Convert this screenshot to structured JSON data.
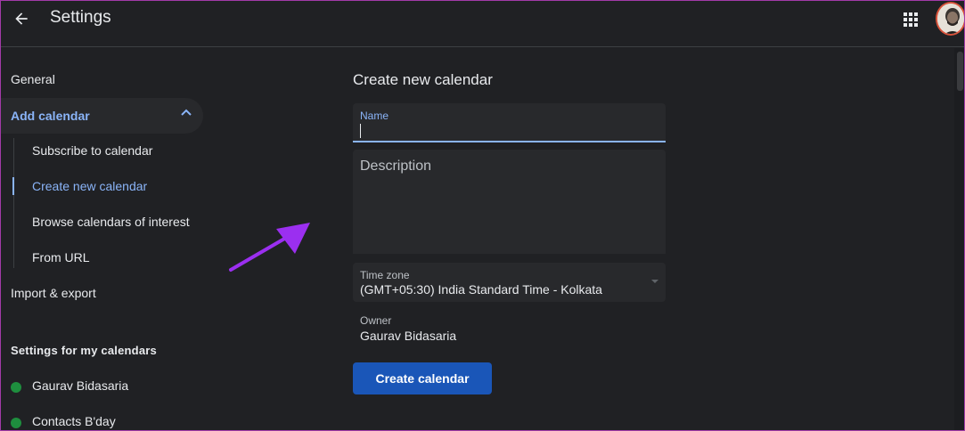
{
  "header": {
    "title": "Settings"
  },
  "sidebar": {
    "general": "General",
    "add_calendar": "Add calendar",
    "sub_items": [
      "Subscribe to calendar",
      "Create new calendar",
      "Browse calendars of interest",
      "From URL"
    ],
    "import_export": "Import & export",
    "section_title": "Settings for my calendars",
    "calendars": [
      {
        "name": "Gaurav Bidasaria",
        "color": "#1e8e3e"
      },
      {
        "name": "Contacts B'day",
        "color": "#1e8e3e"
      }
    ]
  },
  "main": {
    "title": "Create new calendar",
    "name_label": "Name",
    "name_value": "",
    "description_placeholder": "Description",
    "timezone_label": "Time zone",
    "timezone_value": "(GMT+05:30) India Standard Time - Kolkata",
    "owner_label": "Owner",
    "owner_value": "Gaurav Bidasaria",
    "create_button": "Create calendar"
  },
  "colors": {
    "accent": "#8ab4f8",
    "button": "#1a56b8",
    "annotation_arrow": "#9b2ff0",
    "background": "#202124"
  },
  "icons": [
    "arrow-back-icon",
    "apps-grid-icon",
    "chevron-up-icon",
    "dropdown-caret-icon"
  ]
}
